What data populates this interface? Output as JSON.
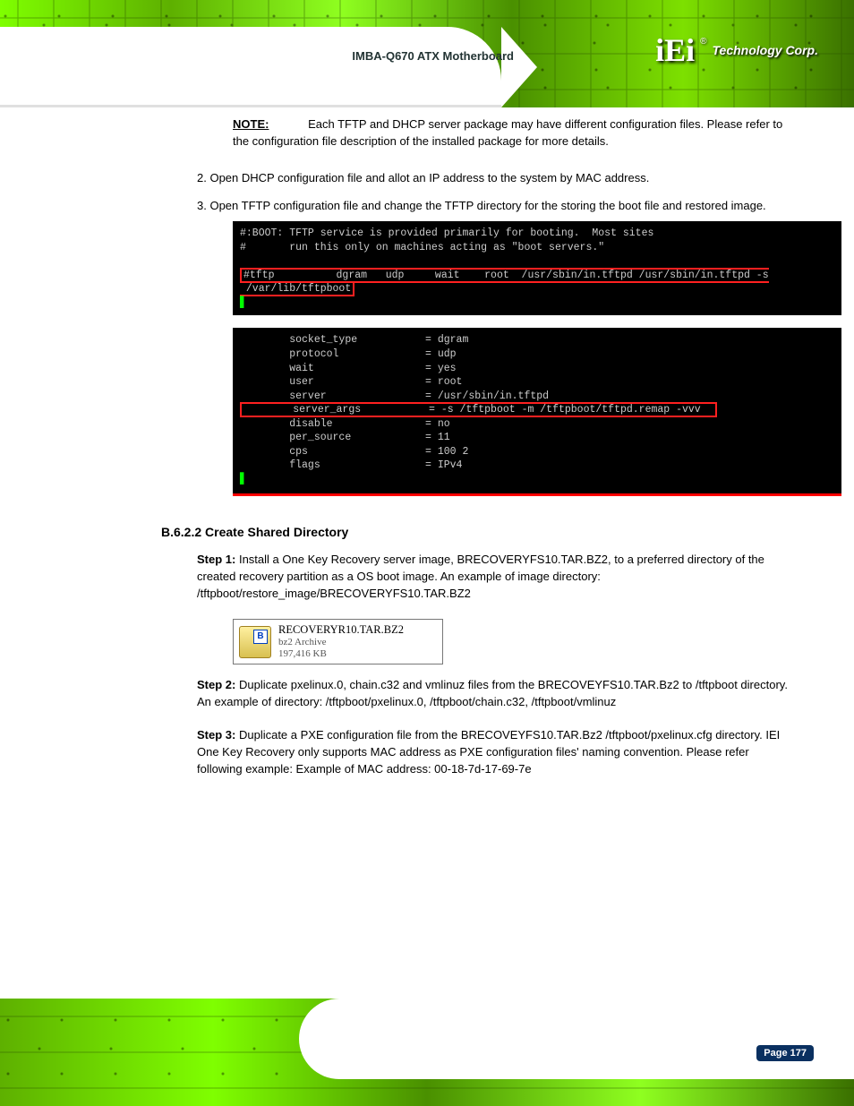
{
  "header": {
    "logo_letters": "iEi",
    "logo_reg": "®",
    "logo_tag": "Technology Corp.",
    "product": "IMBA-Q670 ATX Motherboard"
  },
  "note": {
    "label": "NOTE:",
    "body": "Each TFTP and DHCP server package may have different configuration files. Please refer to the configuration file description of the installed package for more details."
  },
  "steps": {
    "s2": "2. Open DHCP configuration file and allot an IP address to the system by MAC address.",
    "s3": "3. Open TFTP configuration file and change the TFTP directory for the storing the boot file and restored image.",
    "t1_l1": "#:BOOT: TFTP service is provided primarily for booting.  Most sites",
    "t1_l2": "#       run this only on machines acting as \"boot servers.\"",
    "t1_l3": "#tftp          dgram   udp     wait    root  /usr/sbin/in.tftpd /usr/sbin/in.tftpd -s",
    "t1_l4": " /var/lib/tftpboot",
    "t2_l1": "        socket_type           = dgram",
    "t2_l2": "        protocol              = udp",
    "t2_l3": "        wait                  = yes",
    "t2_l4": "        user                  = root",
    "t2_l5": "        server                = /usr/sbin/in.tftpd",
    "t2_l6a": "        server_args           ",
    "t2_l6b": "= -s /tftpboot -m /tftpboot/tftpd.remap -vvv  ",
    "t2_l7": "        disable               = no",
    "t2_l8": "        per_source            = 11",
    "t2_l9": "        cps                   = 100 2",
    "t2_l10": "        flags                 = IPv4"
  },
  "subhead": "B.6.2.2 Create Shared Directory",
  "create": {
    "s1a": "Step 1: ",
    "s1b": "Install a One Key Recovery server image, BRECOVERYFS10.TAR.BZ2, to a preferred directory of the created recovery partition as a OS boot image. An example of image directory: /tftpboot/restore_image/BRECOVERYFS10.TAR.BZ2",
    "file_name": "RECOVERYR10.TAR.BZ2",
    "file_type": "bz2 Archive",
    "file_size": "197,416 KB",
    "s2a": "Step 2: ",
    "s2b": "Duplicate pxelinux.0, chain.c32 and vmlinuz files from the BRECOVEYFS10.TAR.Bz2 to /tftpboot directory. An example of directory: /tftpboot/pxelinux.0, /tftpboot/chain.c32, /tftpboot/vmlinuz",
    "s3a": "Step 3: ",
    "s3b": "Duplicate a PXE configuration file from the BRECOVEYFS10.TAR.Bz2 /tftpboot/pxelinux.cfg directory. IEI One Key Recovery only supports MAC address as PXE configuration files' naming convention. Please refer following example: Example of MAC address: 00-18-7d-17-69-7e"
  },
  "footer": {
    "page": "Page 177"
  }
}
